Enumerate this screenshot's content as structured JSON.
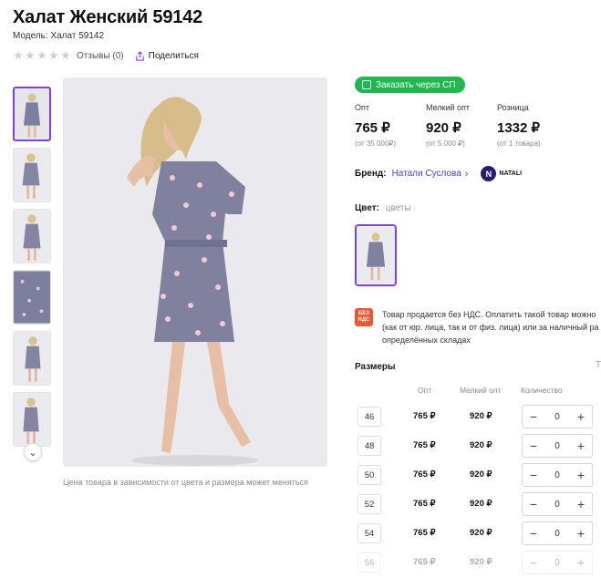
{
  "product": {
    "title": "Халат Женский 59142",
    "model": "Модель: Халат 59142",
    "reviews": "Отзывы (0)",
    "share": "Поделиться",
    "price_note": "Цена товара в зависимости от цвета и размера может меняться"
  },
  "rating": {
    "value": 0,
    "max": 5
  },
  "buy": {
    "sp_button": "Заказать через СП"
  },
  "prices": [
    {
      "label": "Опт",
      "value": "765 ₽",
      "sub": "(от 35 000₽)"
    },
    {
      "label": "Мелкий опт",
      "value": "920 ₽",
      "sub": "(от 5 000 ₽)"
    },
    {
      "label": "Розница",
      "value": "1332 ₽",
      "sub": "(от 1 товара)"
    }
  ],
  "brand": {
    "key": "Бренд:",
    "name": "Натали Суслова",
    "logo_letter": "N",
    "logo_text": "NATALI"
  },
  "color": {
    "key": "Цвет:",
    "value": "цветы"
  },
  "vat": {
    "badge_line1": "БЕЗ",
    "badge_line2": "НДС",
    "line1": "Товар продается без НДС. Оплатить такой товар можно",
    "line2": "(как от юр. лица, так и от физ. лица) или за наличный ра",
    "line3": "определённых складах"
  },
  "sizes": {
    "heading": "Размеры",
    "link": "Т",
    "col_opt": "Опт",
    "col_small": "Мелкий опт",
    "col_qty": "Количество",
    "rows": [
      {
        "size": "46",
        "opt": "765 ₽",
        "small": "920 ₽",
        "qty": "0"
      },
      {
        "size": "48",
        "opt": "765 ₽",
        "small": "920 ₽",
        "qty": "0"
      },
      {
        "size": "50",
        "opt": "765 ₽",
        "small": "920 ₽",
        "qty": "0"
      },
      {
        "size": "52",
        "opt": "765 ₽",
        "small": "920 ₽",
        "qty": "0"
      },
      {
        "size": "54",
        "opt": "765 ₽",
        "small": "920 ₽",
        "qty": "0"
      },
      {
        "size": "56",
        "opt": "765 ₽",
        "small": "920 ₽",
        "qty": "0"
      }
    ]
  },
  "colors": {
    "accent": "#7b3ff2",
    "sp_green": "#1fb84f",
    "brand_link": "#5b3ccf",
    "vat_badge": "#f0562e"
  },
  "icons": {
    "share": "share-icon",
    "star": "star-icon",
    "cart": "cart-icon",
    "chevron": "chevron-down-icon"
  }
}
